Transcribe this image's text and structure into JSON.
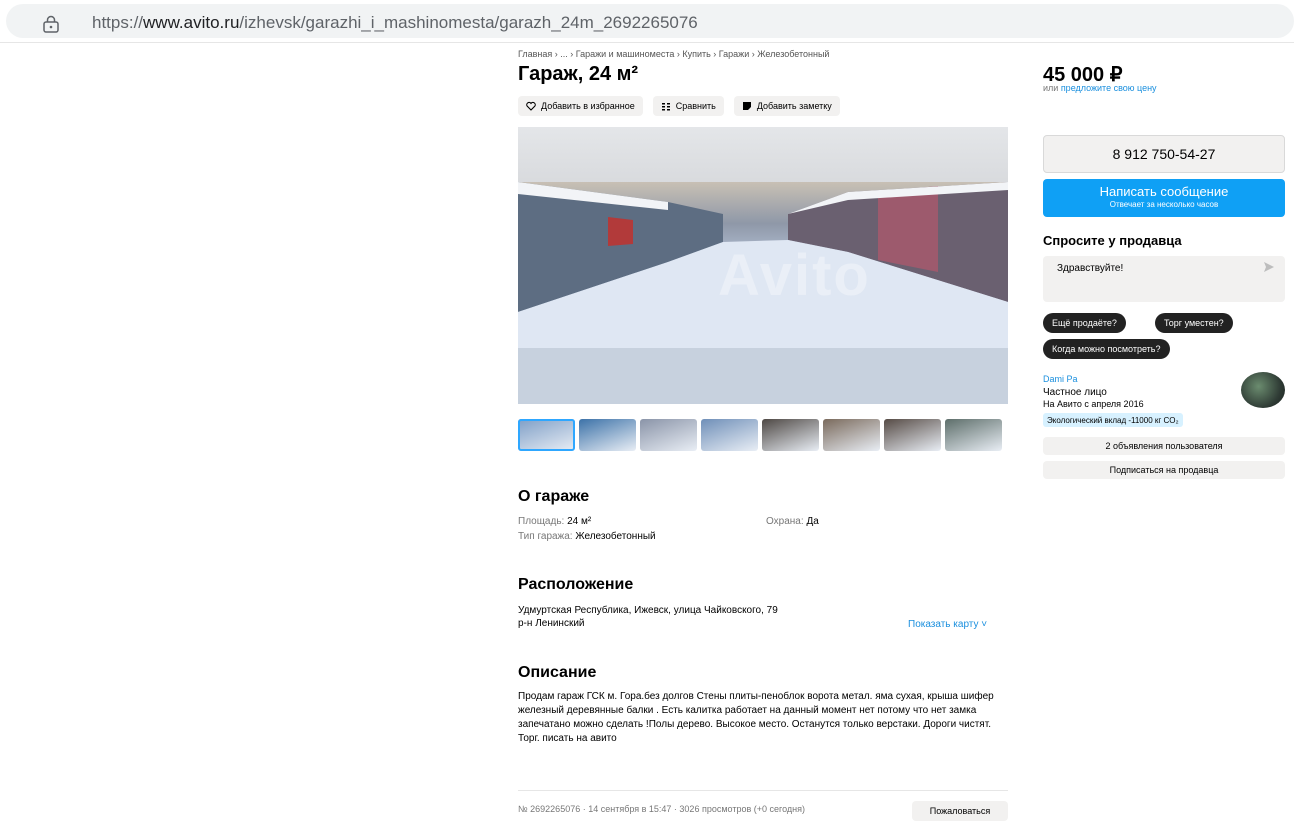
{
  "browser": {
    "url_prefix": "https://",
    "url_domain": "www.avito.ru",
    "url_path": "/izhevsk/garazhi_i_mashinomesta/garazh_24m_2692265076"
  },
  "breadcrumbs": "Главная › ... › Гаражи и машиноместа › Купить › Гаражи › Железобетонный",
  "title": "Гараж, 24 м²",
  "actions": {
    "favorite": "Добавить в избранное",
    "compare": "Сравнить",
    "note": "Добавить заметку"
  },
  "photo": {
    "watermark": "Avito",
    "thumbnail_colors": [
      "#7e9ec6",
      "#3c72a8",
      "#8a94a8",
      "#6f8fb8",
      "#4e4844",
      "#7a6a5c",
      "#564b45",
      "#5d6e6a"
    ]
  },
  "about": {
    "heading": "О гараже",
    "area_label": "Площадь:",
    "area_value": "24 м²",
    "security_label": "Охрана:",
    "security_value": "Да",
    "type_label": "Тип гаража:",
    "type_value": "Железобетонный"
  },
  "location": {
    "heading": "Расположение",
    "address": "Удмуртская Республика, Ижевск, улица Чайковского, 79",
    "district": "р-н Ленинский",
    "show_map": "Показать карту ˅"
  },
  "description": {
    "heading": "Описание",
    "text": "Продам гараж ГСК м. Гора.без долгов Стены плиты-пеноблок ворота метал. яма сухая, крыша шифер железный деревянные балки . Есть калитка работает на данный момент нет потому что нет замка запечатано можно сделать !Полы дерево. Высокое место. Останутся только верстаки. Дороги чистят. Торг. писать на авито"
  },
  "footer": {
    "meta": "№ 2692265076 · 14 сентября в 15:47 · 3026 просмотров (+0 сегодня)",
    "report": "Пожаловаться"
  },
  "sidebar": {
    "price": "45 000 ₽",
    "offer_prefix": "или ",
    "offer_link": "предложите свою цену",
    "phone": "8 912 750-54-27",
    "message_button": "Написать сообщение",
    "message_sub": "Отвечает за несколько часов",
    "ask_heading": "Спросите у продавца",
    "ask_placeholder": "Здравствуйте!",
    "quick_replies": [
      "Ещё продаёте?",
      "Торг уместен?",
      "Когда можно посмотреть?"
    ],
    "seller": {
      "name": "Dami Pa",
      "type": "Частное лицо",
      "since": "На Авито с апреля 2016",
      "eco": "Экологический вклад -11000 кг CO₂",
      "ads_button": "2 объявления пользователя",
      "subscribe_button": "Подписаться на продавца"
    }
  },
  "colors": {
    "accent": "#0fa0f5",
    "link": "#1a8fde",
    "chip": "#222222",
    "button_bg": "#f2f1f0"
  }
}
